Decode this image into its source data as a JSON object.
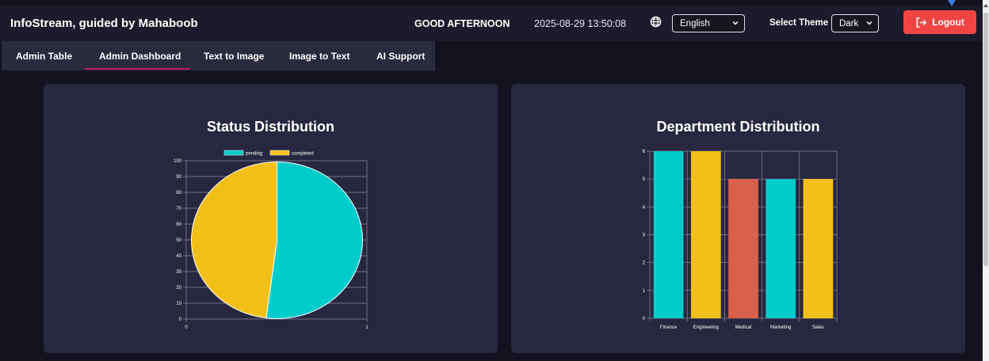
{
  "header": {
    "brand": "InfoStream, guided by Mahaboob",
    "greeting": "GOOD AFTERNOON",
    "datetime": "2025-08-29 13:50:08",
    "language_value": "English",
    "theme_label": "Select Theme",
    "theme_value": "Dark",
    "logout_label": "Logout",
    "icons": [
      "globe-icon",
      "chevron-down-icon",
      "logout-icon"
    ]
  },
  "tabs": [
    {
      "label": "Admin Table"
    },
    {
      "label": "Admin Dashboard",
      "active": true
    },
    {
      "label": "Text to Image"
    },
    {
      "label": "Image to Text"
    },
    {
      "label": "AI Support"
    }
  ],
  "colors": {
    "teal": "#00cccc",
    "yellow": "#f2c019",
    "coral": "#d9604a",
    "accent": "#c2185b",
    "logout": "#ef4444"
  },
  "cards": {
    "status_title": "Status Distribution",
    "department_title": "Department Distribution"
  },
  "chart_data": [
    {
      "type": "pie",
      "title": "Status Distribution",
      "legend": [
        "pending",
        "completed"
      ],
      "labels": [
        "pending",
        "completed"
      ],
      "values": [
        52,
        48
      ],
      "y_ticks": [
        "0",
        "10",
        "20",
        "30",
        "40",
        "50",
        "60",
        "70",
        "80",
        "90",
        "100"
      ],
      "x_ticks": [
        "0",
        "1"
      ],
      "grid": true,
      "legend_position": "top"
    },
    {
      "type": "bar",
      "title": "Department Distribution",
      "categories": [
        "Finance",
        "Engineering",
        "Medical",
        "Marketing",
        "Sales"
      ],
      "values": [
        6,
        6,
        5,
        5,
        5
      ],
      "ylim": [
        0,
        6
      ],
      "y_ticks": [
        "0",
        "1",
        "2",
        "3",
        "4",
        "5",
        "6"
      ],
      "grid": true
    }
  ]
}
